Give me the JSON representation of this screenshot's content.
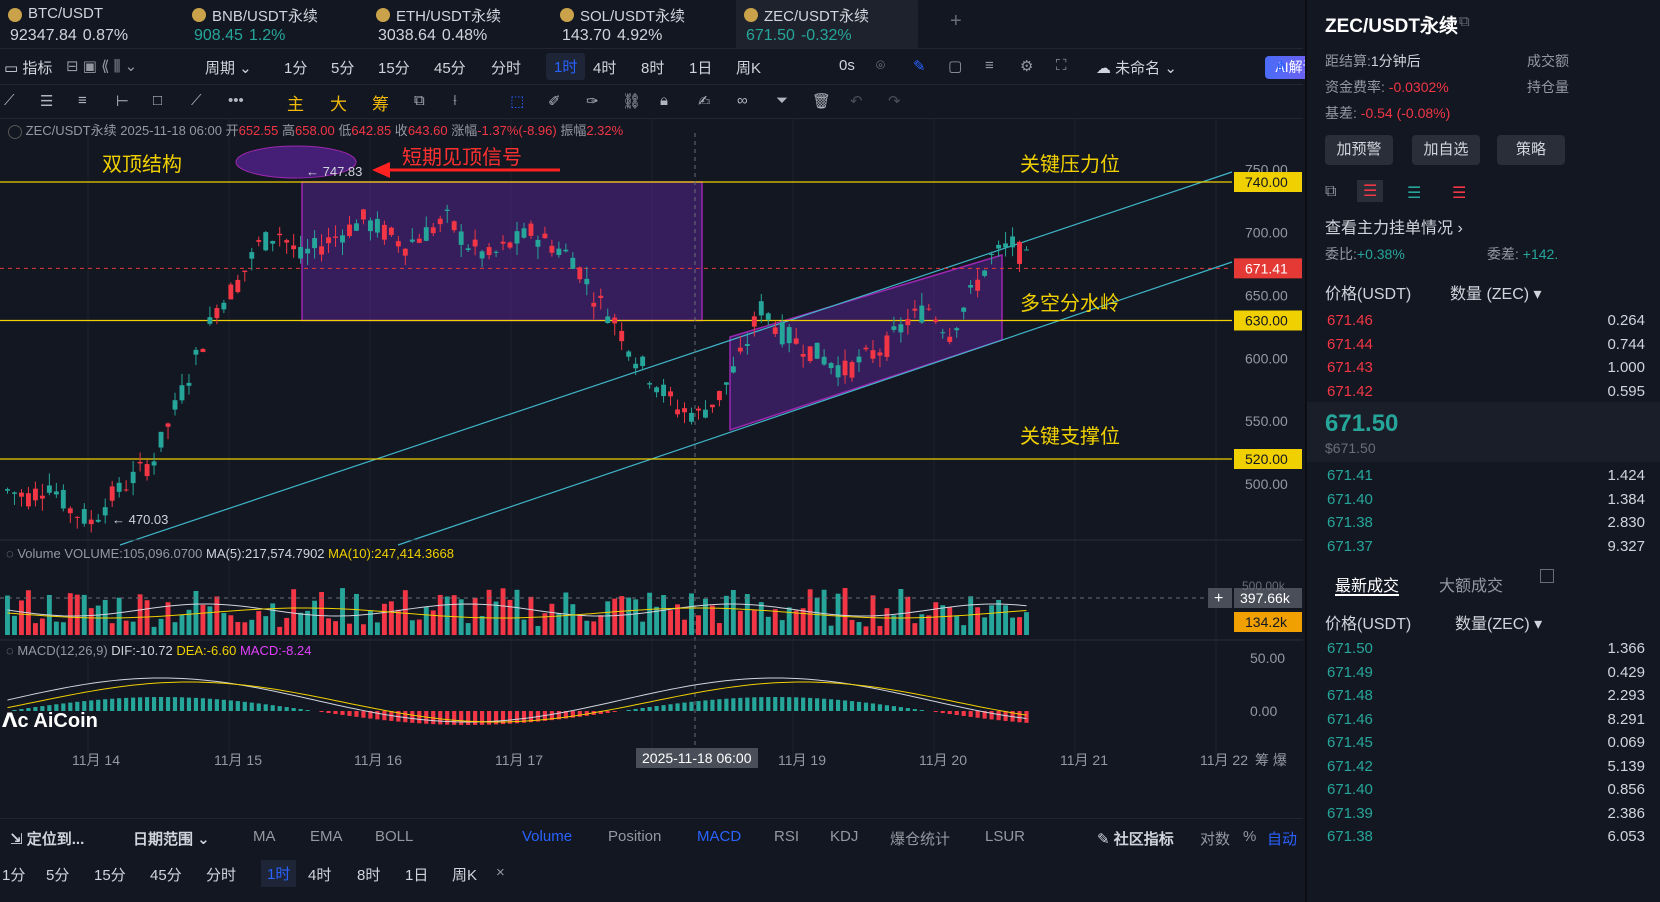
{
  "tickers": [
    {
      "name": "BTC/USDT",
      "price": "92347.84",
      "change": "0.87%",
      "color": "#d1d4dc",
      "change_color": "#d1d4dc"
    },
    {
      "name": "BNB/USDT永续",
      "price": "908.45",
      "change": "1.2%",
      "color": "#26a69a",
      "change_color": "#26a69a"
    },
    {
      "name": "ETH/USDT永续",
      "price": "3038.64",
      "change": "0.48%",
      "color": "#d1d4dc",
      "change_color": "#d1d4dc"
    },
    {
      "name": "SOL/USDT永续",
      "price": "143.70",
      "change": "4.92%",
      "color": "#d1d4dc",
      "change_color": "#d1d4dc"
    },
    {
      "name": "ZEC/USDT永续",
      "price": "671.50",
      "change": "-0.32%",
      "color": "#26a69a",
      "change_color": "#26a69a"
    }
  ],
  "toolbar1": {
    "indicators": "指标",
    "period": "周期",
    "intervals": [
      "1分",
      "5分",
      "15分",
      "45分",
      "分时",
      "1时",
      "4时",
      "8时",
      "1日",
      "周K"
    ],
    "active_interval": "1时",
    "countdown": "0s",
    "layout_name": "未命名",
    "ai": "AI解读"
  },
  "toolbar2": {
    "labels": [
      "主",
      "大",
      "筹"
    ]
  },
  "chart": {
    "header": {
      "symbol": "ZEC/USDT永续",
      "date": "2025-11-18 06:00",
      "open_label": "开",
      "open": "652.55",
      "high_label": "高",
      "high": "658.00",
      "low_label": "低",
      "low": "642.85",
      "close_label": "收",
      "close": "643.60",
      "chg_label": "涨幅",
      "chg": "-1.37%(-8.96)",
      "amp_label": "振幅",
      "amp": "2.32%"
    },
    "annotations": {
      "double_top": "双顶结构",
      "short_top": "短期见顶信号",
      "key_resistance": "关键压力位",
      "watershed": "多空分水岭",
      "key_support": "关键支撑位",
      "high_mark": "← 747.83",
      "low_mark": "← 470.03"
    },
    "price_axis": [
      "750.00",
      "700.00",
      "650.00",
      "600.00",
      "550.00",
      "500.00"
    ],
    "level_tags": [
      {
        "label": "740.00",
        "value": 740,
        "bg": "#f0d000"
      },
      {
        "label": "671.41",
        "value": 671.41,
        "bg": "#e53935"
      },
      {
        "label": "630.00",
        "value": 630,
        "bg": "#f0d000"
      },
      {
        "label": "520.00",
        "value": 520,
        "bg": "#f0d000"
      }
    ],
    "time_axis": [
      "11月 14",
      "11月 15",
      "11月 16",
      "11月 17",
      "2025-11-18 06:00",
      "11月 19",
      "11月 20",
      "11月 21",
      "11月 22"
    ],
    "time_axis_tail": "筹 爆",
    "volume": {
      "label": "Volume",
      "vol": "VOLUME:105,096.0700",
      "ma5": "MA(5):217,574.7902",
      "ma10": "MA(10):247,414.3668",
      "axis_top": "500.00k",
      "tag1": "397.66k",
      "tag2": "134.2k"
    },
    "macd": {
      "label": "MACD(12,26,9)",
      "dif": "DIF:-10.72",
      "dea": "DEA:-6.60",
      "macd": "MACD:-8.24",
      "axis": [
        "50.00",
        "0.00"
      ]
    },
    "watermark": "AiCoin"
  },
  "chart_data": {
    "type": "candlestick",
    "title": "ZEC/USDT永续",
    "x_range": [
      "11月 14",
      "11月 21"
    ],
    "ylim": [
      450,
      760
    ],
    "close_approx": [
      495,
      490,
      500,
      480,
      470,
      490,
      505,
      520,
      560,
      600,
      640,
      660,
      690,
      700,
      680,
      690,
      700,
      710,
      700,
      690,
      700,
      710,
      690,
      680,
      690,
      700,
      690,
      680,
      650,
      630,
      600,
      580,
      560,
      555,
      570,
      600,
      640,
      620,
      610,
      600,
      590,
      600,
      610,
      630,
      640,
      620,
      650,
      680,
      690,
      671.5
    ],
    "levels": {
      "resistance": 740,
      "current": 671.41,
      "watershed": 630,
      "support": 520,
      "high": 747.83,
      "low": 470.03
    }
  },
  "bottom1": {
    "locate": "定位到...",
    "date_range": "日期范围",
    "items": [
      "MA",
      "EMA",
      "BOLL",
      "Volume",
      "Position",
      "MACD",
      "RSI",
      "KDJ",
      "爆仓统计",
      "LSUR"
    ],
    "community": "社区指标",
    "log": "对数",
    "pct": "%",
    "auto": "自动"
  },
  "bottom2": {
    "intervals": [
      "1分",
      "5分",
      "15分",
      "45分",
      "分时",
      "1时",
      "4时",
      "8时",
      "1日",
      "周K"
    ],
    "active": "1时",
    "close": "×"
  },
  "right": {
    "title": "ZEC/USDT永续",
    "settle_label": "距结算:",
    "settle_val": "1分钟后",
    "turnover": "成交额",
    "funding_label": "资金费率:",
    "funding_val": "-0.0302%",
    "oi": "持仓量",
    "basis_label": "基差:",
    "basis_val": "-0.54 (-0.08%)",
    "buttons": [
      "加预警",
      "加自选",
      "策略"
    ],
    "depth_link": "查看主力挂单情况",
    "ratio_label": "委比:",
    "ratio_val": "+0.38%",
    "diff_label": "委差:",
    "diff_val": "+142.",
    "ob_header_price": "价格(USDT)",
    "ob_header_qty": "数量 (ZEC)",
    "asks": [
      [
        "671.46",
        "0.264"
      ],
      [
        "671.44",
        "0.744"
      ],
      [
        "671.43",
        "1.000"
      ],
      [
        "671.42",
        "0.595"
      ]
    ],
    "last_price": "671.50",
    "last_price_sub": "$671.50",
    "bids": [
      [
        "671.41",
        "1.424"
      ],
      [
        "671.40",
        "1.384"
      ],
      [
        "671.38",
        "2.830"
      ],
      [
        "671.37",
        "9.327"
      ]
    ],
    "trade_tabs": [
      "最新成交",
      "大额成交"
    ],
    "tr_header_price": "价格(USDT)",
    "tr_header_qty": "数量(ZEC)",
    "trades": [
      [
        "671.50",
        "1.366"
      ],
      [
        "671.49",
        "0.429"
      ],
      [
        "671.48",
        "2.293"
      ],
      [
        "671.46",
        "8.291"
      ],
      [
        "671.45",
        "0.069"
      ],
      [
        "671.42",
        "5.139"
      ],
      [
        "671.40",
        "0.856"
      ],
      [
        "671.39",
        "2.386"
      ],
      [
        "671.38",
        "6.053"
      ]
    ]
  }
}
